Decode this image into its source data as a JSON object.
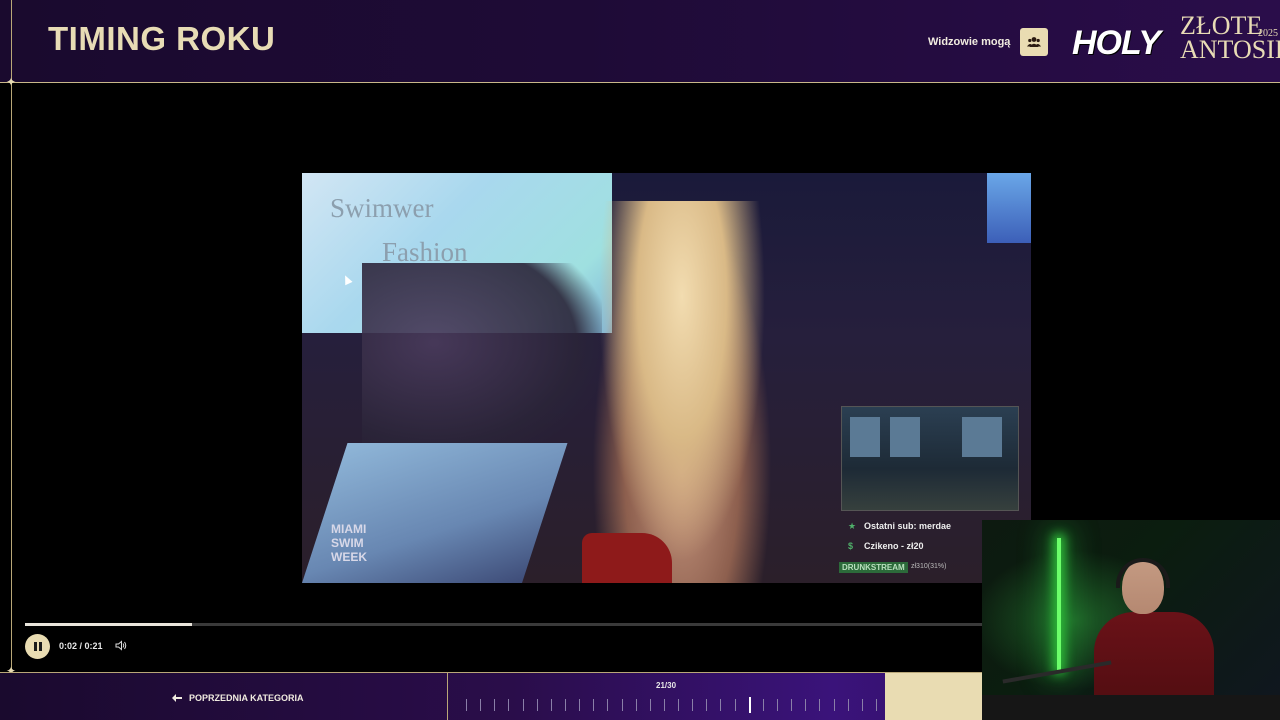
{
  "header": {
    "title": "TIMING ROKU",
    "viewers_label": "Widzowie mogą",
    "logo_holy": "HOLY",
    "logo_line1": "ZŁOTE",
    "logo_line2": "ANTOSIE",
    "logo_year": "2025"
  },
  "video": {
    "overlay_line1": "Swimwer",
    "overlay_line2": "Fashion",
    "brand_line1": "MIAMI",
    "brand_line2": "SWIM",
    "brand_line3": "WEEK"
  },
  "stream_overlay": {
    "last_sub": "Ostatni sub: merdae",
    "donation": "Czikeno - zł20",
    "tag": "DRUNKSTREAM",
    "goal": "zł310(31%)"
  },
  "player": {
    "time": "0:02 / 0:21",
    "progress": 0.175,
    "state": "playing"
  },
  "footer": {
    "prev_category": "POPRZEDNIA KATEGORIA",
    "counter": "21/30",
    "total_ticks": 30,
    "active_tick": 21
  },
  "colors": {
    "gold": "#e9dcb2",
    "purple_dark": "#1a0a2e",
    "purple": "#3a137a"
  }
}
